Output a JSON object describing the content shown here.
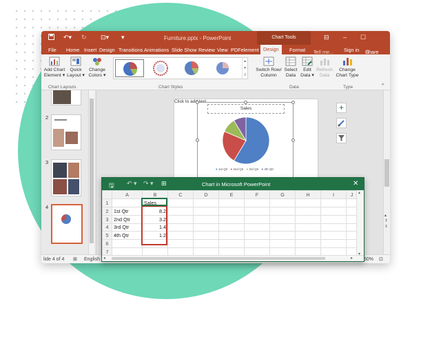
{
  "window": {
    "title": "Furniture.pptx - PowerPoint",
    "context_tab": "Chart Tools",
    "sign_in": "Sign in",
    "share": "Share",
    "tell_me": "Tell me..."
  },
  "menu": [
    "File",
    "Home",
    "Insert",
    "Design",
    "Transitions",
    "Animations",
    "Slide Show",
    "Review",
    "View",
    "PDFelement",
    "Design",
    "Format"
  ],
  "ribbon": {
    "add_chart_element": [
      "Add Chart",
      "Element"
    ],
    "quick_layout": [
      "Quick",
      "Layout"
    ],
    "change_colors": [
      "Change",
      "Colors"
    ],
    "switch_row_column": [
      "Switch Row/",
      "Column"
    ],
    "select_data": [
      "Select",
      "Data"
    ],
    "edit_data": [
      "Edit",
      "Data"
    ],
    "refresh_data": [
      "Refresh",
      "Data"
    ],
    "change_chart_type": [
      "Change",
      "Chart Type"
    ],
    "groups": {
      "layouts": "Chart Layouts",
      "styles": "Chart Styles",
      "data": "Data",
      "type": "Type"
    }
  },
  "thumbnails": [
    {
      "num": "2"
    },
    {
      "num": "3"
    },
    {
      "num": "4"
    }
  ],
  "slide": {
    "placeholder": "Click to add text",
    "chart_title": "Sales"
  },
  "status": {
    "slide_info": "lide 4 of 4",
    "language": "English",
    "zoom": "50%"
  },
  "chart_data": {
    "type": "pie",
    "title": "Sales",
    "categories": [
      "1st Qtr",
      "2nd Qtr",
      "3rd Qtr",
      "4th Qtr"
    ],
    "values": [
      8.2,
      3.2,
      1.4,
      1.2
    ],
    "colors": [
      "#4f7fc4",
      "#c94d48",
      "#9bbb59",
      "#8064a2"
    ]
  },
  "excel": {
    "title": "Chart in Microsoft PowerPoint",
    "columns": [
      "A",
      "B",
      "C",
      "D",
      "E",
      "F",
      "G",
      "H",
      "I",
      "J"
    ],
    "rows": [
      {
        "num": "1",
        "a": "",
        "b": "Sales"
      },
      {
        "num": "2",
        "a": "1st Qtr",
        "b": "8.2"
      },
      {
        "num": "3",
        "a": "2nd Qtr",
        "b": "3.2"
      },
      {
        "num": "4",
        "a": "3rd Qtr",
        "b": "1.4"
      },
      {
        "num": "5",
        "a": "4th Qtr",
        "b": "1.2"
      },
      {
        "num": "6",
        "a": "",
        "b": ""
      },
      {
        "num": "7",
        "a": "",
        "b": ""
      }
    ]
  }
}
